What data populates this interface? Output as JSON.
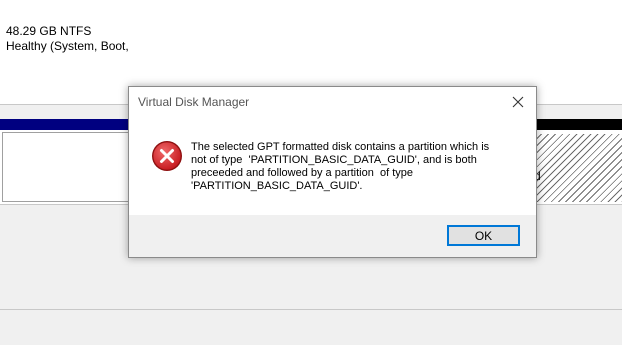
{
  "background": {
    "volume_size": "48.29 GB NTFS",
    "volume_status": "Healthy (System, Boot,",
    "right_status_fragment": "d"
  },
  "dialog": {
    "title": "Virtual Disk Manager",
    "close_icon": "close-icon",
    "error_icon": "error-icon",
    "message": "The selected GPT formatted disk contains a partition which is\nnot of type  'PARTITION_BASIC_DATA_GUID', and is both\npreceeded and followed by a partition  of type\n'PARTITION_BASIC_DATA_GUID'.",
    "ok_label": "OK"
  },
  "colors": {
    "error_red": "#d6242d",
    "accent_blue": "#0078d7",
    "disk_bar_blue": "#000080"
  }
}
